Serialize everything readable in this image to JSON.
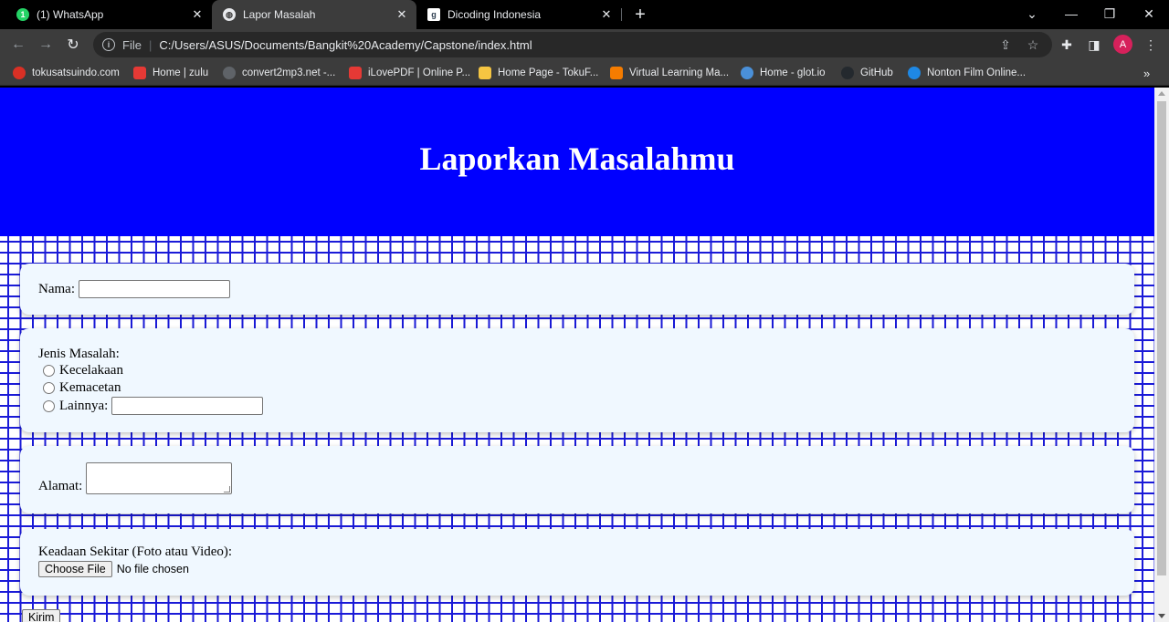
{
  "browser": {
    "tabs": [
      {
        "title": "(1) WhatsApp",
        "icon": "whatsapp-icon",
        "active": false
      },
      {
        "title": "Lapor Masalah",
        "icon": "globe-icon",
        "active": true
      },
      {
        "title": "Dicoding Indonesia",
        "icon": "dicoding-icon",
        "active": false
      }
    ],
    "address": {
      "scheme": "File",
      "url": "C:/Users/ASUS/Documents/Bangkit%20Academy/Capstone/index.html"
    },
    "profile_initial": "A",
    "bookmarks": [
      {
        "label": "tokusatsuindo.com",
        "color": "#d93025"
      },
      {
        "label": "Home | zulu",
        "color": "#e53935"
      },
      {
        "label": "convert2mp3.net -...",
        "color": "#5f6368"
      },
      {
        "label": "iLovePDF | Online P...",
        "color": "#e53935"
      },
      {
        "label": "Home Page - TokuF...",
        "color": "#f5c542"
      },
      {
        "label": "Virtual Learning Ma...",
        "color": "#f57c00"
      },
      {
        "label": "Home - glot.io",
        "color": "#4a90d9"
      },
      {
        "label": "GitHub",
        "color": "#24292e"
      },
      {
        "label": "Nonton Film Online...",
        "color": "#1e88e5"
      }
    ]
  },
  "page": {
    "title": "Laporkan Masalahmu",
    "nama_label": "Nama:",
    "jenis_label": "Jenis Masalah:",
    "options": [
      "Kecelakaan",
      "Kemacetan",
      "Lainnya:"
    ],
    "alamat_label": "Alamat:",
    "keadaan_label": "Keadaan Sekitar (Foto atau Video):",
    "file_button": "Choose File",
    "file_status": "No file chosen",
    "submit_label": "Kirim"
  }
}
